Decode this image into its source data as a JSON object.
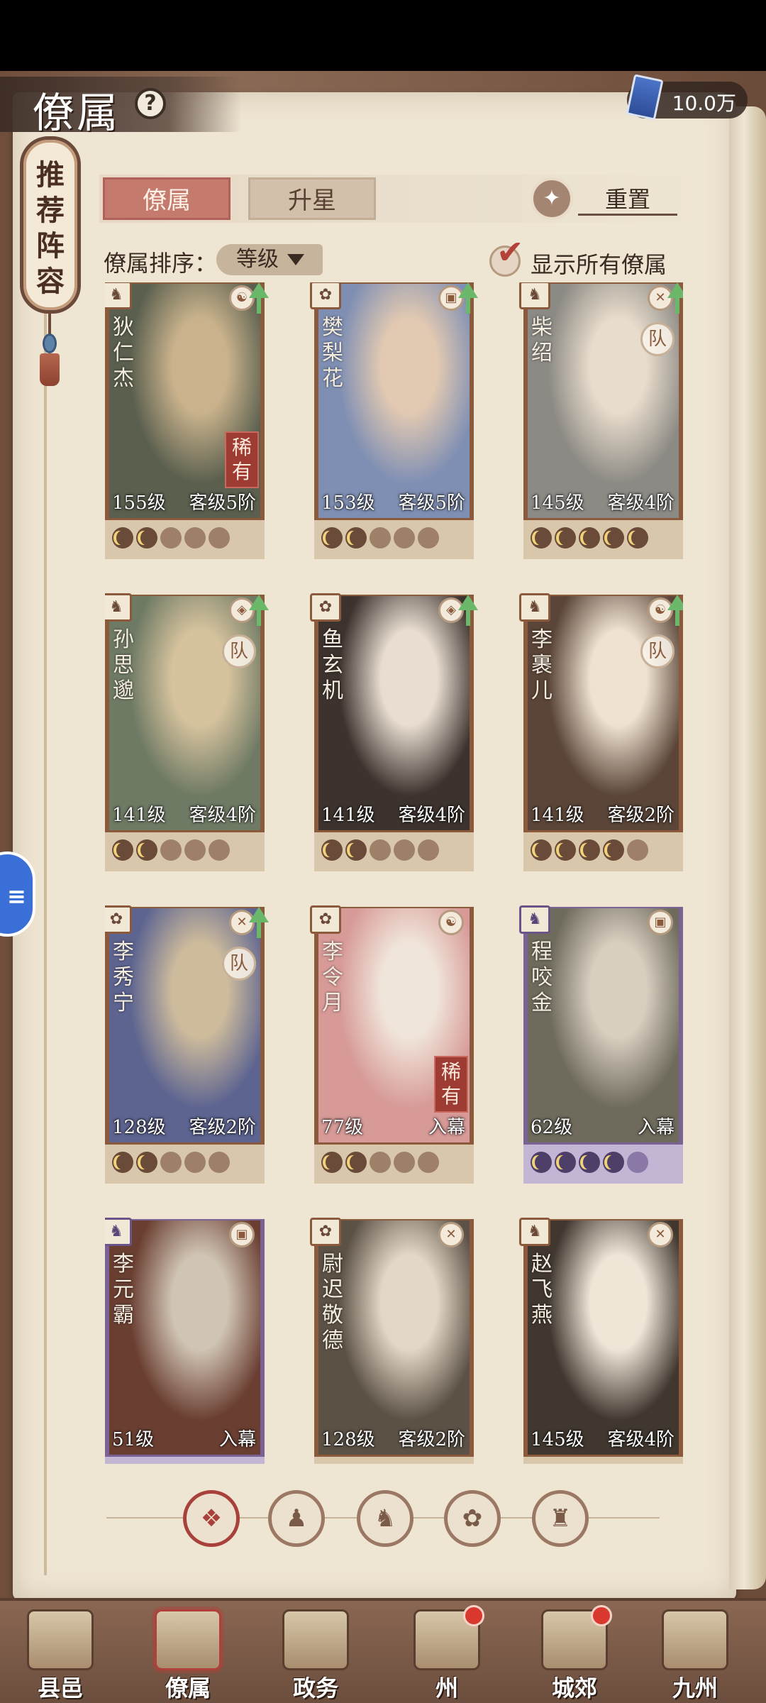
{
  "header": {
    "title": "僚属",
    "help": "?",
    "currency_value": "10.0万"
  },
  "recommend_tag": "推荐阵容",
  "tabs": [
    {
      "label": "僚属",
      "active": true
    },
    {
      "label": "升星",
      "active": false
    }
  ],
  "reset_label": "重置",
  "sort": {
    "label": "僚属排序：",
    "value": "等级"
  },
  "show_all": {
    "label": "显示所有僚属",
    "checked": true
  },
  "cards": [
    {
      "name": "狄仁杰",
      "level": "155级",
      "rank": "客级5阶",
      "rare": "稀有",
      "team": "",
      "up": true,
      "purple": false,
      "lit_moons": 2,
      "skill_icon": "☯",
      "type_icon": "♞",
      "art": "#5a5f4e",
      "art2": "#c9b28c"
    },
    {
      "name": "樊梨花",
      "level": "153级",
      "rank": "客级5阶",
      "rare": "",
      "team": "",
      "up": true,
      "purple": false,
      "lit_moons": 2,
      "skill_icon": "▣",
      "type_icon": "✿",
      "art": "#7f8fb3",
      "art2": "#e2c9b2"
    },
    {
      "name": "柴绍",
      "level": "145级",
      "rank": "客级4阶",
      "rare": "",
      "team": "队",
      "up": true,
      "purple": false,
      "lit_moons": 5,
      "skill_icon": "✕",
      "type_icon": "♞",
      "art": "#8c8a84",
      "art2": "#e8dccc"
    },
    {
      "name": "孙思邈",
      "level": "141级",
      "rank": "客级4阶",
      "rare": "",
      "team": "队",
      "up": true,
      "purple": false,
      "lit_moons": 2,
      "skill_icon": "◈",
      "type_icon": "♞",
      "art": "#6f7a64",
      "art2": "#d6c39e"
    },
    {
      "name": "鱼玄机",
      "level": "141级",
      "rank": "客级4阶",
      "rare": "",
      "team": "",
      "up": true,
      "purple": false,
      "lit_moons": 2,
      "skill_icon": "◈",
      "type_icon": "✿",
      "art": "#3d332e",
      "art2": "#e8ddd0"
    },
    {
      "name": "李裹儿",
      "level": "141级",
      "rank": "客级2阶",
      "rare": "",
      "team": "队",
      "up": true,
      "purple": false,
      "lit_moons": 4,
      "skill_icon": "☯",
      "type_icon": "♞",
      "art": "#5a4538",
      "art2": "#efe2d1"
    },
    {
      "name": "李秀宁",
      "level": "128级",
      "rank": "客级2阶",
      "rare": "",
      "team": "队",
      "up": true,
      "purple": false,
      "lit_moons": 2,
      "skill_icon": "✕",
      "type_icon": "✿",
      "art": "#5d6490",
      "art2": "#cdbb9c"
    },
    {
      "name": "李令月",
      "level": "77级",
      "rank": "入幕",
      "rare": "稀有",
      "team": "",
      "up": false,
      "purple": false,
      "lit_moons": 2,
      "skill_icon": "☯",
      "type_icon": "✿",
      "art": "#d79a97",
      "art2": "#f0e5da"
    },
    {
      "name": "程咬金",
      "level": "62级",
      "rank": "入幕",
      "rare": "",
      "team": "",
      "up": false,
      "purple": true,
      "lit_moons": 4,
      "skill_icon": "▣",
      "type_icon": "♞",
      "art": "#6e6a5c",
      "art2": "#d8cfc0"
    },
    {
      "name": "李元霸",
      "level": "51级",
      "rank": "入幕",
      "rare": "",
      "team": "",
      "up": false,
      "purple": true,
      "lit_moons": 0,
      "skill_icon": "▣",
      "type_icon": "♞",
      "art": "#6a3f32",
      "art2": "#d0c4b4"
    },
    {
      "name": "尉迟敬德",
      "level": "128级",
      "rank": "客级2阶",
      "rare": "",
      "team": "",
      "up": false,
      "purple": false,
      "lit_moons": 0,
      "skill_icon": "✕",
      "type_icon": "✿",
      "art": "#5b5145",
      "art2": "#e3d8c7"
    },
    {
      "name": "赵飞燕",
      "level": "145级",
      "rank": "客级4阶",
      "rare": "",
      "team": "",
      "up": false,
      "purple": false,
      "lit_moons": 0,
      "skill_icon": "✕",
      "type_icon": "♞",
      "art": "#40382f",
      "art2": "#efe6d8"
    }
  ],
  "filters": [
    {
      "icon": "❖",
      "active": true
    },
    {
      "icon": "♟",
      "active": false
    },
    {
      "icon": "♞",
      "active": false
    },
    {
      "icon": "✿",
      "active": false
    },
    {
      "icon": "♜",
      "active": false
    }
  ],
  "bottom_nav": [
    {
      "label": "县邑",
      "active": false,
      "dot": false
    },
    {
      "label": "僚属",
      "active": true,
      "dot": false
    },
    {
      "label": "政务",
      "active": false,
      "dot": false
    },
    {
      "label": "州",
      "active": false,
      "dot": true
    },
    {
      "label": "城郊",
      "active": false,
      "dot": true
    },
    {
      "label": "九州",
      "active": false,
      "dot": false
    }
  ],
  "side_float": "≡"
}
